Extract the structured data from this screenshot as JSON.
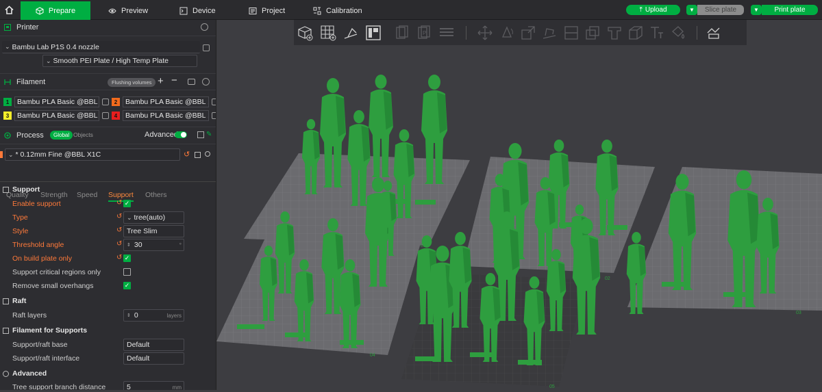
{
  "topbar": {
    "tabs": [
      {
        "label": "Prepare",
        "icon": "cube-icon",
        "active": true
      },
      {
        "label": "Preview",
        "icon": "eye-icon",
        "active": false
      },
      {
        "label": "Device",
        "icon": "device-icon",
        "active": false
      },
      {
        "label": "Project",
        "icon": "project-icon",
        "active": false
      },
      {
        "label": "Calibration",
        "icon": "calibration-icon",
        "active": false
      }
    ],
    "upload_label": "Upload",
    "slice_label": "Slice plate",
    "print_label": "Print plate",
    "accent_color": "#00ae42"
  },
  "printer": {
    "title": "Printer",
    "name": "Bambu Lab P1S 0.4 nozzle",
    "plate": "Smooth PEI Plate / High Temp Plate"
  },
  "filament": {
    "title": "Filament",
    "flushing_label": "Flushing volumes",
    "items": [
      {
        "num": "1",
        "color": "#00ae42",
        "name": "Bambu PLA Basic @BBL ..."
      },
      {
        "num": "2",
        "color": "#f26b1d",
        "name": "Bambu PLA Basic @BBL ..."
      },
      {
        "num": "3",
        "color": "#f4ee2a",
        "name": "Bambu PLA Basic @BBL ..."
      },
      {
        "num": "4",
        "color": "#e81e1e",
        "name": "Bambu PLA Basic @BBL ..."
      }
    ]
  },
  "process": {
    "title": "Process",
    "global_label": "Global",
    "objects_label": "Objects",
    "advanced_label": "Advanced",
    "preset": "* 0.12mm Fine @BBL X1C",
    "tabs": [
      "Quality",
      "Strength",
      "Speed",
      "Support",
      "Others"
    ]
  },
  "support": {
    "section": "Support",
    "enable_label": "Enable support",
    "type_label": "Type",
    "type_value": "tree(auto)",
    "style_label": "Style",
    "style_value": "Tree Slim",
    "threshold_label": "Threshold angle",
    "threshold_value": "30",
    "threshold_unit": "°",
    "on_build_label": "On build plate only",
    "critical_label": "Support critical regions only",
    "remove_label": "Remove small overhangs"
  },
  "raft": {
    "section": "Raft",
    "layers_label": "Raft layers",
    "layers_value": "0",
    "layers_unit": "layers"
  },
  "filament_supports": {
    "section": "Filament for Supports",
    "base_label": "Support/raft base",
    "base_value": "Default",
    "interface_label": "Support/raft interface",
    "interface_value": "Default"
  },
  "advanced": {
    "section": "Advanced",
    "branch_label": "Tree support branch distance",
    "branch_value": "5",
    "branch_unit": "mm"
  },
  "viewport": {
    "plate_labels": [
      "01",
      "02",
      "03",
      "04",
      "05"
    ],
    "model_color": "#2e9e3f"
  }
}
